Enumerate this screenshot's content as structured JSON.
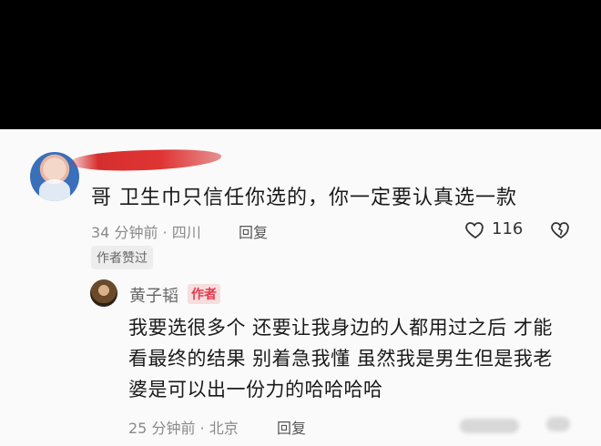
{
  "comment": {
    "text": "哥  卫生巾只信任你选的，你一定要认真选一款",
    "time_location": "34 分钟前 · 四川",
    "reply_label": "回复",
    "like_count": "116",
    "author_liked_badge": "作者赞过"
  },
  "reply": {
    "author_name": "黄子韬",
    "author_tag": "作者",
    "lines": [
      "我要选很多个 还要让我身边的人都用过之后 才能",
      "看最终的结果 别着急我懂 虽然我是男生但是我老",
      "婆是可以出一份力的哈哈哈哈"
    ],
    "time_location": "25 分钟前 · 北京",
    "reply_label": "回复"
  },
  "colors": {
    "accent_red": "#e53a4f",
    "redaction": "#d62e2e"
  }
}
